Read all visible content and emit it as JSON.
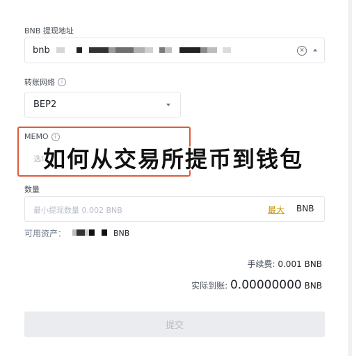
{
  "address": {
    "label": "BNB 提现地址",
    "value": "bnb",
    "clear_icon": "close-circle-icon",
    "caret_icon": "caret-up-icon"
  },
  "network": {
    "label": "转账网络",
    "info_icon": "info-icon",
    "selected": "BEP2",
    "caret_icon": "caret-down-icon"
  },
  "memo": {
    "label": "MEMO",
    "info_icon": "info-icon",
    "placeholder": "选填",
    "highlight_color": "#e05a3a"
  },
  "amount": {
    "label": "数量",
    "placeholder": "最小提现数量 0.002 BNB",
    "max_label": "最大",
    "unit": "BNB"
  },
  "available": {
    "label": "可用资产：",
    "unit": "BNB"
  },
  "fee": {
    "label": "手续费:",
    "value": "0.001",
    "unit": "BNB"
  },
  "received": {
    "label": "实际到账:",
    "value": "0.00000000",
    "unit": "BNB"
  },
  "submit_label": "提交",
  "overlay_title": "如何从交易所提币到钱包",
  "colors": {
    "accent": "#c99400",
    "highlight": "#e05a3a"
  }
}
